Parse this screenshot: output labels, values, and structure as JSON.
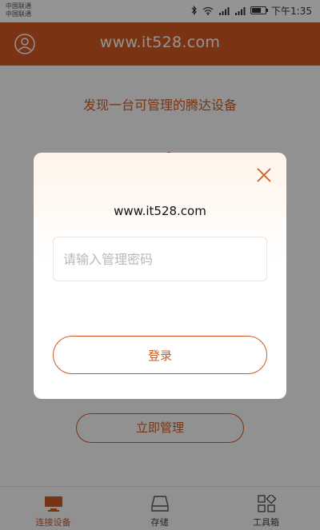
{
  "status_bar": {
    "carrier_1": "中国联通",
    "carrier_2": "中国联通",
    "time": "下午1:35",
    "battery_level": 0.6
  },
  "header": {
    "title": "www.it528.com",
    "avatar_icon": "user-circle-icon"
  },
  "main": {
    "discover_text": "发现一台可管理的腾达设备",
    "manage_button_label": "立即管理"
  },
  "tabs": [
    {
      "label": "连接设备",
      "icon": "monitor-icon",
      "active": true
    },
    {
      "label": "存储",
      "icon": "storage-drive-icon",
      "active": false
    },
    {
      "label": "工具箱",
      "icon": "grid-apps-icon",
      "active": false
    }
  ],
  "modal": {
    "title": "www.it528.com",
    "password_placeholder": "请输入管理密码",
    "password_value": "",
    "login_label": "登录",
    "close_icon": "close-icon"
  },
  "colors": {
    "accent": "#d35a24",
    "overlay": "rgba(0,0,0,0.42)"
  }
}
